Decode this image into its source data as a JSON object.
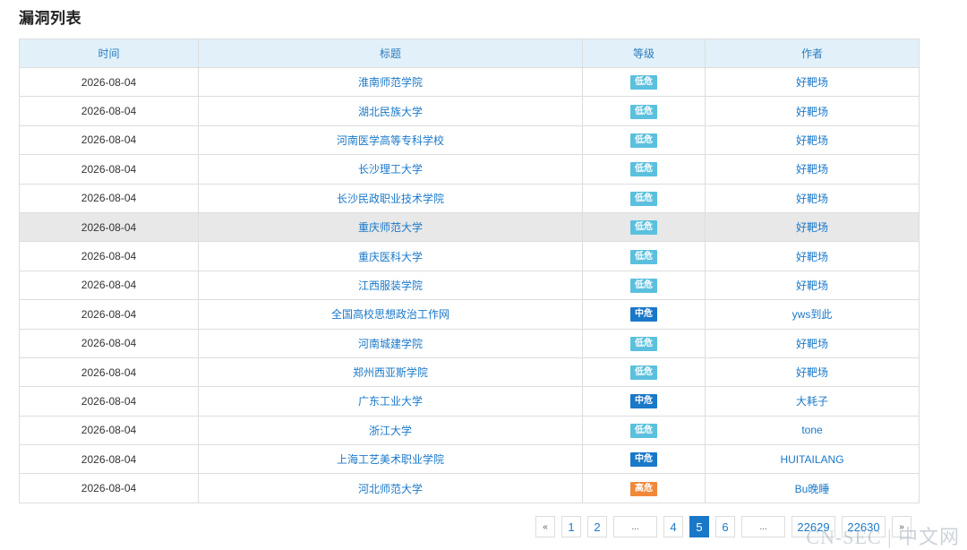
{
  "page": {
    "title": "漏洞列表"
  },
  "table": {
    "headers": {
      "time": "时间",
      "title": "标题",
      "level": "等级",
      "author": "作者"
    },
    "rows": [
      {
        "time": "2026-08-04",
        "title": "淮南师范学院",
        "level": "低危",
        "level_type": "low",
        "author": "好靶场"
      },
      {
        "time": "2026-08-04",
        "title": "湖北民族大学",
        "level": "低危",
        "level_type": "low",
        "author": "好靶场"
      },
      {
        "time": "2026-08-04",
        "title": "河南医学高等专科学校",
        "level": "低危",
        "level_type": "low",
        "author": "好靶场"
      },
      {
        "time": "2026-08-04",
        "title": "长沙理工大学",
        "level": "低危",
        "level_type": "low",
        "author": "好靶场"
      },
      {
        "time": "2026-08-04",
        "title": "长沙民政职业技术学院",
        "level": "低危",
        "level_type": "low",
        "author": "好靶场"
      },
      {
        "time": "2026-08-04",
        "title": "重庆师范大学",
        "level": "低危",
        "level_type": "low",
        "author": "好靶场"
      },
      {
        "time": "2026-08-04",
        "title": "重庆医科大学",
        "level": "低危",
        "level_type": "low",
        "author": "好靶场"
      },
      {
        "time": "2026-08-04",
        "title": "江西服装学院",
        "level": "低危",
        "level_type": "low",
        "author": "好靶场"
      },
      {
        "time": "2026-08-04",
        "title": "全国高校思想政治工作网",
        "level": "中危",
        "level_type": "mid",
        "author": "yws到此"
      },
      {
        "time": "2026-08-04",
        "title": "河南城建学院",
        "level": "低危",
        "level_type": "low",
        "author": "好靶场"
      },
      {
        "time": "2026-08-04",
        "title": "郑州西亚斯学院",
        "level": "低危",
        "level_type": "low",
        "author": "好靶场"
      },
      {
        "time": "2026-08-04",
        "title": "广东工业大学",
        "level": "中危",
        "level_type": "mid",
        "author": "大耗子"
      },
      {
        "time": "2026-08-04",
        "title": "浙江大学",
        "level": "低危",
        "level_type": "low",
        "author": "tone"
      },
      {
        "time": "2026-08-04",
        "title": "上海工艺美术职业学院",
        "level": "中危",
        "level_type": "mid",
        "author": "HUITAILANG"
      },
      {
        "time": "2026-08-04",
        "title": "河北师范大学",
        "level": "高危",
        "level_type": "high",
        "author": "Bu晚睡"
      }
    ]
  },
  "pagination": {
    "prev": "«",
    "next": "»",
    "pages": [
      "1",
      "2",
      "...",
      "4",
      "5",
      "6",
      "...",
      "22629",
      "22630"
    ],
    "current": "5"
  },
  "watermark": "CN-SEC | 中文网",
  "colors": {
    "accent": "#1a78c9",
    "header_bg": "#e2f1f9",
    "low": "#5bc0de",
    "mid": "#1a78c9",
    "high": "#f0883a"
  }
}
